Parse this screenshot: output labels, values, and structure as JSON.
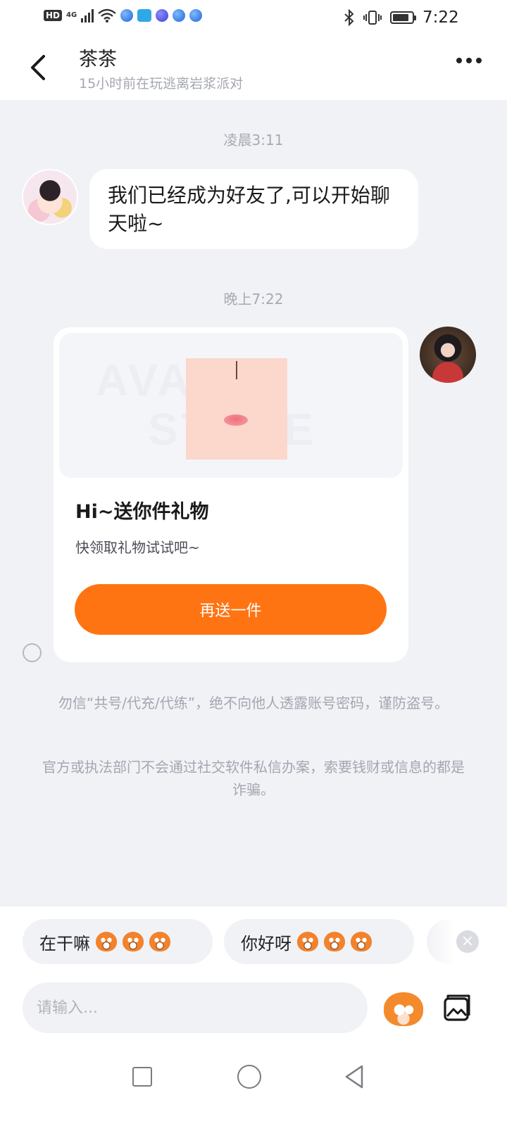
{
  "status_bar": {
    "network_hd": "HD",
    "network_type": "4G",
    "time": "7:22",
    "battery_level": 0.85
  },
  "header": {
    "title": "茶茶",
    "subtitle": "15小时前在玩逃离岩浆派对"
  },
  "messages": {
    "timestamp_1": "凌晨3:11",
    "friend_text": "我们已经成为好友了,可以开始聊天啦~",
    "timestamp_2": "晚上7:22"
  },
  "gift_card": {
    "watermark_line1": "AVATAR",
    "watermark_line2": "STORE",
    "title": "Hi~送你件礼物",
    "description": "快领取礼物试试吧~",
    "button_label": "再送一件"
  },
  "notices": {
    "line_1": "勿信“共号/代充/代练”，绝不向他人透露账号密码，谨防盗号。",
    "line_2": "官方或执法部门不会通过社交软件私信办案，索要钱财或信息的都是诈骗。"
  },
  "quick_replies": [
    {
      "label": "在干嘛"
    },
    {
      "label": "你好呀"
    }
  ],
  "input": {
    "placeholder": "请输入..."
  },
  "colors": {
    "accent": "#ff7412",
    "background": "#f1f2f6"
  },
  "icons": {
    "back": "chevron-left-icon",
    "more": "more-dots-icon",
    "emoji": "emoji-icon",
    "image": "image-icon"
  }
}
